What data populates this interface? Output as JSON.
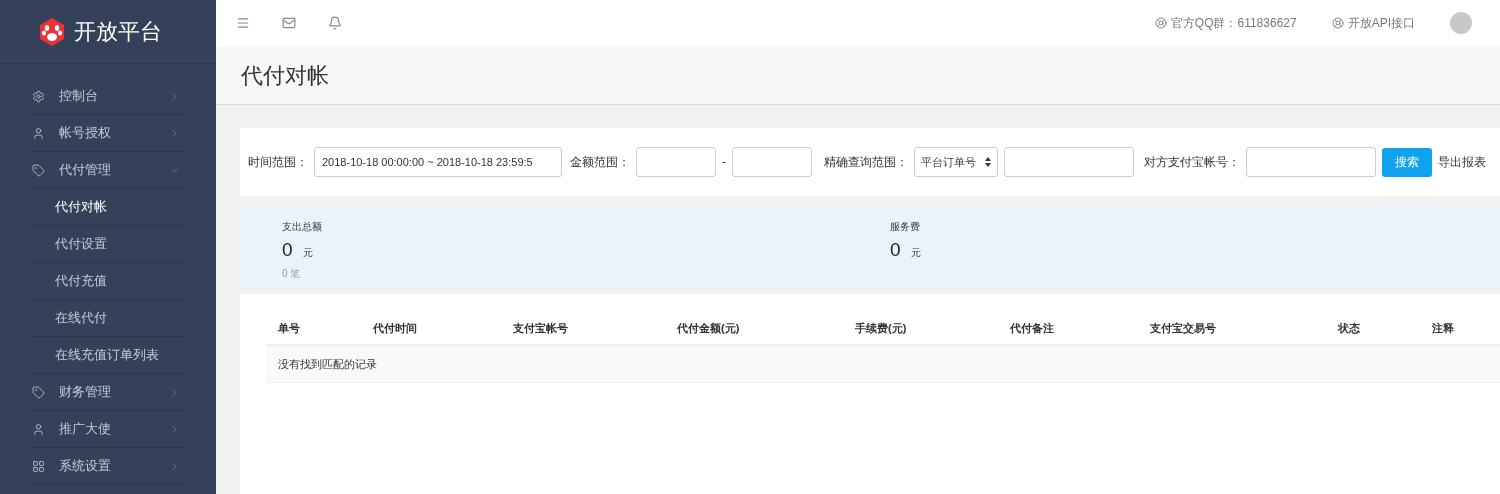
{
  "brand": {
    "name": "开放平台"
  },
  "sidebar": {
    "items": [
      {
        "label": "控制台",
        "expanded": false
      },
      {
        "label": "帐号授权",
        "expanded": false
      },
      {
        "label": "代付管理",
        "expanded": true,
        "children": [
          {
            "label": "代付对帐",
            "selected": true
          },
          {
            "label": "代付设置",
            "selected": false
          },
          {
            "label": "代付充值",
            "selected": false
          },
          {
            "label": "在线代付",
            "selected": false
          },
          {
            "label": "在线充值订单列表",
            "selected": false
          }
        ]
      },
      {
        "label": "财务管理",
        "expanded": false
      },
      {
        "label": "推广大使",
        "expanded": false
      },
      {
        "label": "系统设置",
        "expanded": false
      }
    ]
  },
  "header": {
    "links": [
      {
        "label": "官方QQ群：611836627"
      },
      {
        "label": "开放API接口"
      }
    ]
  },
  "page_title": "代付对帐",
  "filters": {
    "time_label": "时间范围：",
    "time_value": "2018-10-18 00:00:00 ~ 2018-10-18 23:59:5",
    "amount_label": "金额范围：",
    "amount_separator": "-",
    "exact_label": "精确查询范围：",
    "exact_select": "平台订单号",
    "account_label": "对方支付宝帐号：",
    "search_button": "搜索",
    "export_link": "导出报表"
  },
  "summary": [
    {
      "title": "支出总额",
      "value": "0",
      "unit": "元",
      "note": "0 笔"
    },
    {
      "title": "服务费",
      "value": "0",
      "unit": "元"
    }
  ],
  "table": {
    "columns": [
      "单号",
      "代付时间",
      "支付宝帐号",
      "代付金额(元)",
      "手续费(元)",
      "代付备注",
      "支付宝交易号",
      "状态",
      "注释"
    ],
    "empty_message": "没有找到匹配的记录"
  }
}
